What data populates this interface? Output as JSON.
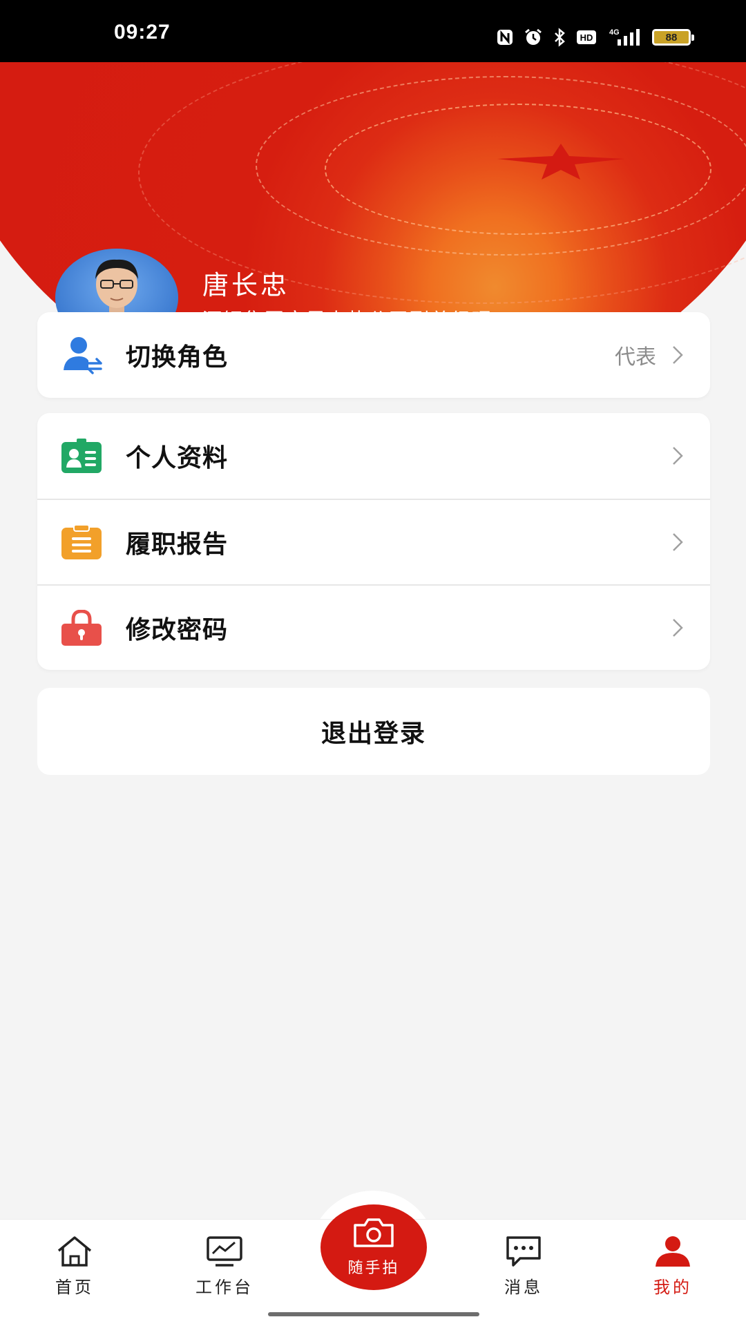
{
  "status_bar": {
    "time": "09:27",
    "battery": "88",
    "network": "4G",
    "icons": [
      "nfc-icon",
      "alarm-icon",
      "bluetooth-icon",
      "hd-icon",
      "signal-icon",
      "battery-icon"
    ]
  },
  "profile": {
    "name": "唐长忠",
    "title": "酒钢集团宏晟电热公司副总经理",
    "banner_color": "#d41a12"
  },
  "role_card": {
    "label": "切换角色",
    "value": "代表",
    "icon": "switch-user-icon",
    "icon_color": "#2f7be0"
  },
  "menu": {
    "items": [
      {
        "label": "个人资料",
        "icon": "id-card-icon",
        "icon_color": "#21a865"
      },
      {
        "label": "履职报告",
        "icon": "clipboard-icon",
        "icon_color": "#f2a02a"
      },
      {
        "label": "修改密码",
        "icon": "lock-icon",
        "icon_color": "#e8504a"
      }
    ]
  },
  "logout": {
    "label": "退出登录"
  },
  "tabbar": {
    "tabs": [
      {
        "label": "首页",
        "icon": "home-icon"
      },
      {
        "label": "工作台",
        "icon": "monitor-chart-icon"
      },
      {
        "label": "随手拍",
        "icon": "camera-icon"
      },
      {
        "label": "消息",
        "icon": "message-icon"
      },
      {
        "label": "我的",
        "icon": "user-icon",
        "active": true
      }
    ],
    "active_color": "#d41a12"
  }
}
